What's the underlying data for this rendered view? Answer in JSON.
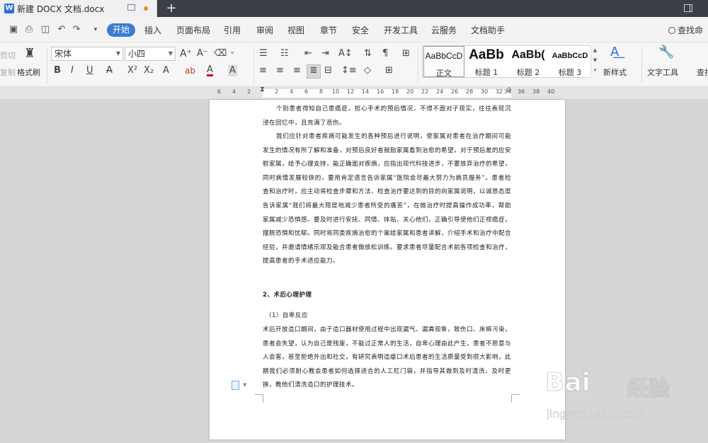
{
  "titlebar": {
    "doc_tab_title": "新建 DOCX 文档.docx",
    "app_icon": "W",
    "new_tab": "+"
  },
  "menu": {
    "items": [
      "开始",
      "插入",
      "页面布局",
      "引用",
      "审阅",
      "视图",
      "章节",
      "安全",
      "开发工具",
      "云服务",
      "文档助手"
    ],
    "active": "开始",
    "search": "查找命"
  },
  "ribbon": {
    "cut": "剪切",
    "copy": "复制",
    "format_painter": "格式刷",
    "font_name": "宋体",
    "font_size": "小四",
    "styles": [
      {
        "preview": "AaBbCcD",
        "name": "正文"
      },
      {
        "preview": "AaBb",
        "name": "标题 1"
      },
      {
        "preview": "AaBb(",
        "name": "标题 2"
      },
      {
        "preview": "AaBbCcD",
        "name": "标题 3"
      }
    ],
    "new_style": "新样式",
    "text_tools": "文字工具",
    "find_replace": "查找"
  },
  "ruler": {
    "ticks": [
      "6",
      "4",
      "2",
      "2",
      "4",
      "6",
      "8",
      "10",
      "12",
      "14",
      "16",
      "18",
      "20",
      "22",
      "24",
      "26",
      "28",
      "30",
      "32",
      "34",
      "36",
      "38",
      "40"
    ]
  },
  "document": {
    "p1": "个别患者得知自己患癌症，担心手术的预后情况，不得不面对子现实，往往表现沉浸在回忆中，且充满了悲伤。",
    "p2": "我们应针对患者疾病可能发生的各种预后进行说明，使家属对患者在治疗期间可能发生的情况有所了解和准备，对预后良好者鼓励家属看到治愈的希望，对于预后差的应安慰家属，给予心理支持，能正确面对疾病，应指出现代科技进步，不要放弃治疗的希望，同时病情发展较快的，要用肯定语言告诉家属“医院会尽最大努力为病员服务”。患者检查和治疗时，应主动将检查步骤和方法、检查治疗要达到的目的向家属说明，以诚恳态度告诉家属“我们将最大限度地减少患者所受的痛苦”，在做治疗时提高操作成功率，帮助家属减少恐惧感。要及时进行安抚、同情、体贴、关心他们，正确引导使他们正视癌症，摆脱恐惧和忧郁。同时将同类疾病治愈的个案给家属和患者讲解，介绍手术和治疗中配合经验，并邀请情绪乐观及能合患者做放松训练。要求患者尽量配合术前各项检查和治疗，提高患者的手术适应能力。",
    "heading": "2、术后心理护理",
    "sub_heading": "（1）自卑反应",
    "p3": "术后开放造口期间，由于造口器材使用过程中出现漏气、漏粪现象，致伤口、床裤污染，患者会失望，认为自己是残废，不能过正常人的生活，自卑心理由此产生，患者不愿意与人会客，甚至拒绝外出和社交，有研究表明造瘘口术后患者的生活质量受到很大影响，此期我们必须耐心教会患者如何选择适合的人工肛门袋，并指导其做到及时清洗、及时更换，教他们清洗造口的护理技术。"
  },
  "watermark": {
    "logo": "Bai",
    "cn": "经验",
    "url": "jingyan.baidu.com"
  },
  "colors": {
    "accent": "#3a7bd5",
    "titlebar": "#3b3f47"
  }
}
